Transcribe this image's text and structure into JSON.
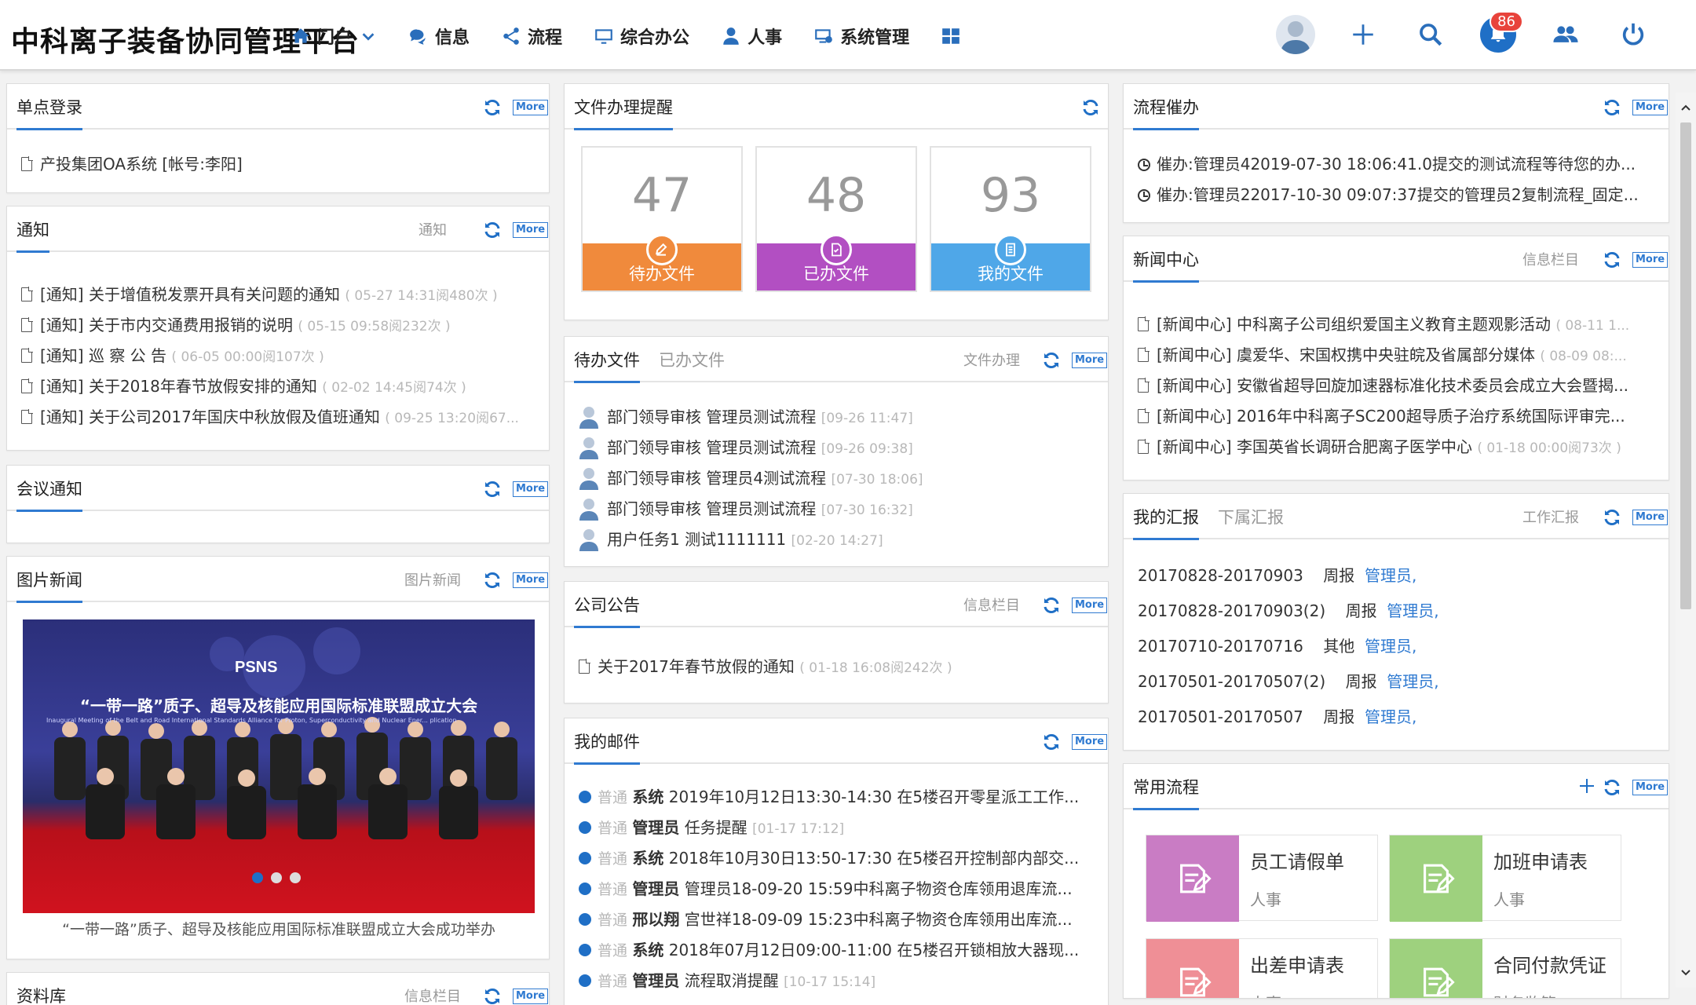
{
  "header": {
    "logo": "中科离子装备协同管理平台",
    "nav": [
      {
        "label": "门户",
        "icon": "home-icon"
      },
      {
        "label": "信息",
        "icon": "chat-icon"
      },
      {
        "label": "流程",
        "icon": "share-icon"
      },
      {
        "label": "综合办公",
        "icon": "desktop-icon"
      },
      {
        "label": "人事",
        "icon": "user-icon"
      },
      {
        "label": "系统管理",
        "icon": "settings-icon"
      }
    ],
    "notification_count": "86"
  },
  "common": {
    "more": "More"
  },
  "sso": {
    "title": "单点登录",
    "items": [
      "产投集团OA系统 [帐号:李阳]"
    ]
  },
  "notice": {
    "title": "通知",
    "category": "通知",
    "items": [
      {
        "text": "[通知] 关于增值税发票开具有关问题的通知",
        "meta": "( 05-27 14:31阅480次 )"
      },
      {
        "text": "[通知] 关于市内交通费用报销的说明",
        "meta": "( 05-15 09:58阅232次 )"
      },
      {
        "text": "[通知] 巡 察 公 告",
        "meta": "( 06-05 00:00阅107次 )"
      },
      {
        "text": "[通知] 关于2018年春节放假安排的通知",
        "meta": "( 02-02 14:45阅74次 )"
      },
      {
        "text": "[通知] 关于公司2017年国庆中秋放假及值班通知",
        "meta": "( 09-25 13:20阅67..."
      }
    ]
  },
  "meeting": {
    "title": "会议通知"
  },
  "photo_news": {
    "title": "图片新闻",
    "category": "图片新闻",
    "logo_text": "PSNS",
    "banner_title": "“一带一路”质子、超导及核能应用国际标准联盟成立大会",
    "banner_subtitle": "Inaugural Meeting of the Belt and Road International Standards Alliance for Proton, Superconductivity and Nuclear Ener... plication",
    "caption": "“一带一路”质子、超导及核能应用国际标准联盟成立大会成功举办"
  },
  "library": {
    "title": "资料库",
    "category": "信息栏目"
  },
  "reminder": {
    "title": "文件办理提醒",
    "stats": [
      {
        "value": "47",
        "label": "待办文件",
        "color": "#f08a3c"
      },
      {
        "value": "48",
        "label": "已办文件",
        "color": "#b24fc2"
      },
      {
        "value": "93",
        "label": "我的文件",
        "color": "#4fa7e8"
      }
    ]
  },
  "todo": {
    "tab_active": "待办文件",
    "tab_inactive": "已办文件",
    "category": "文件办理",
    "items": [
      {
        "text": "部门领导审核  管理员测试流程",
        "meta": "[09-26 11:47]"
      },
      {
        "text": "部门领导审核  管理员测试流程",
        "meta": "[09-26 09:38]"
      },
      {
        "text": "部门领导审核  管理员4测试流程",
        "meta": "[07-30 18:06]"
      },
      {
        "text": "部门领导审核  管理员测试流程",
        "meta": "[07-30 16:32]"
      },
      {
        "text": "用户任务1  测试1111111",
        "meta": "[02-20 14:27]"
      }
    ]
  },
  "announcement": {
    "title": "公司公告",
    "category": "信息栏目",
    "items": [
      {
        "text": "关于2017年春节放假的通知",
        "meta": "( 01-18 16:08阅242次 )"
      }
    ]
  },
  "mail": {
    "title": "我的邮件",
    "items": [
      {
        "level": "普通",
        "sender": "系统",
        "text": "2019年10月12日13:30-14:30 在5楼召开零星派工工作...",
        "meta": ""
      },
      {
        "level": "普通",
        "sender": "管理员",
        "text": "任务提醒",
        "meta": "[01-17 17:12]"
      },
      {
        "level": "普通",
        "sender": "系统",
        "text": "2018年10月30日13:50-17:30 在5楼召开控制部内部交...",
        "meta": ""
      },
      {
        "level": "普通",
        "sender": "管理员",
        "text": "管理员18-09-20 15:59中科离子物资仓库领用退库流...",
        "meta": ""
      },
      {
        "level": "普通",
        "sender": "邢以翔",
        "text": "宫世祥18-09-09 15:23中科离子物资仓库领用出库流...",
        "meta": ""
      },
      {
        "level": "普通",
        "sender": "系统",
        "text": "2018年07月12日09:00-11:00 在5楼召开锁相放大器现...",
        "meta": ""
      },
      {
        "level": "普通",
        "sender": "管理员",
        "text": "流程取消提醒",
        "meta": "[10-17 15:14]"
      }
    ]
  },
  "urge": {
    "title": "流程催办",
    "items": [
      "催办:管理员42019-07-30 18:06:41.0提交的测试流程等待您的办...",
      "催办:管理员22017-10-30 09:07:37提交的管理员2复制流程_固定..."
    ]
  },
  "news": {
    "title": "新闻中心",
    "category": "信息栏目",
    "items": [
      {
        "text": "[新闻中心] 中科离子公司组织爱国主义教育主题观影活动",
        "meta": "( 08-11 1..."
      },
      {
        "text": "[新闻中心] 虞爱华、宋国权携中央驻皖及省属部分媒体",
        "meta": "( 08-09 08:..."
      },
      {
        "text": "[新闻中心] 安徽省超导回旋加速器标准化技术委员会成立大会暨揭...",
        "meta": ""
      },
      {
        "text": "[新闻中心] 2016年中科离子SC200超导质子治疗系统国际评审完...",
        "meta": ""
      },
      {
        "text": "[新闻中心] 李国英省长调研合肥离子医学中心",
        "meta": "( 01-18 00:00阅73次 )"
      }
    ]
  },
  "report": {
    "tab_active": "我的汇报",
    "tab_inactive": "下属汇报",
    "category": "工作汇报",
    "items": [
      {
        "period": "20170828-20170903",
        "type": "周报",
        "person": "管理员,"
      },
      {
        "period": "20170828-20170903(2)",
        "type": "周报",
        "person": "管理员,"
      },
      {
        "period": "20170710-20170716",
        "type": "其他",
        "person": "管理员,"
      },
      {
        "period": "20170501-20170507(2)",
        "type": "周报",
        "person": "管理员,"
      },
      {
        "period": "20170501-20170507",
        "type": "周报",
        "person": "管理员,"
      }
    ]
  },
  "common_flow": {
    "title": "常用流程",
    "tiles": [
      {
        "name": "员工请假单",
        "cat": "人事",
        "color": "#c97cc4"
      },
      {
        "name": "加班申请表",
        "cat": "人事",
        "color": "#9ed17e"
      },
      {
        "name": "出差申请表",
        "cat": "人事",
        "color": "#ef8f96"
      },
      {
        "name": "合同付款凭证",
        "cat": "财务监管",
        "color": "#9ed17e"
      }
    ]
  }
}
